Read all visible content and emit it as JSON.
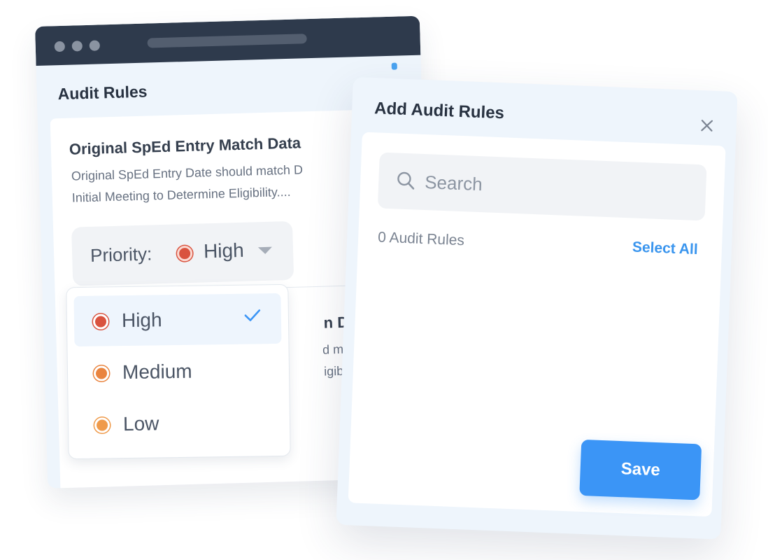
{
  "back_window": {
    "title": "Audit Rules",
    "rules": [
      {
        "title": "Original SpEd Entry Match Data",
        "description_line1": "Original SpEd Entry Date should match D",
        "description_line2": "Initial Meeting to Determine Eligibility...."
      },
      {
        "title_fragment": "n Data",
        "description_line1_fragment": "d match",
        "description_line2_fragment": "igibility.."
      }
    ],
    "priority": {
      "label": "Priority:",
      "value": "High",
      "value_color": "#d9533f"
    },
    "dropdown": {
      "options": [
        {
          "label": "High",
          "color": "#d9533f",
          "selected": true
        },
        {
          "label": "Medium",
          "color": "#e9843f",
          "selected": false
        },
        {
          "label": "Low",
          "color": "#ef9a4a",
          "selected": false
        }
      ],
      "check_icon": "check-icon"
    }
  },
  "modal": {
    "title": "Add Audit Rules",
    "close_icon": "close-icon",
    "search": {
      "placeholder": "Search",
      "value": ""
    },
    "count_text": "0 Audit Rules",
    "select_all_label": "Select All",
    "save_label": "Save"
  },
  "colors": {
    "accent": "#3b95f6",
    "titlebar": "#2e3a4c",
    "panel_bg": "#eef5fc"
  }
}
